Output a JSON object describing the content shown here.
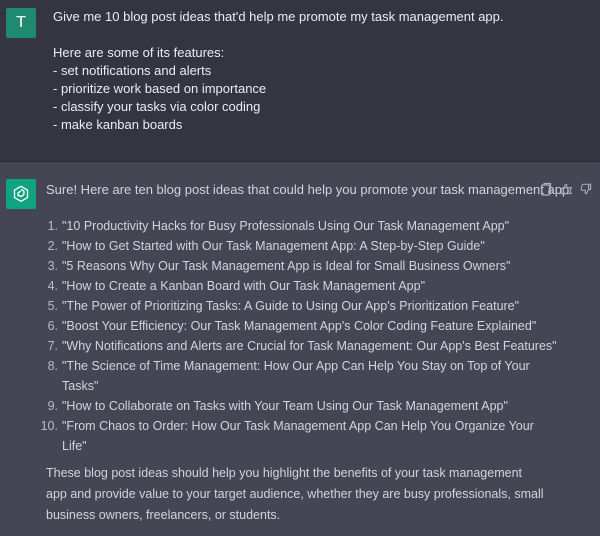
{
  "user": {
    "avatar_initial": "T",
    "avatar_color": "#1f8a70",
    "message_lines": [
      "Give me 10 blog post ideas that'd help me promote my task management app.",
      "",
      "Here are some of its features:",
      "- set notifications and alerts",
      "- prioritize work based on importance",
      "- classify your tasks via color coding",
      "- make kanban boards"
    ]
  },
  "assistant": {
    "avatar_icon": "openai-logo-icon",
    "avatar_color": "#10a37f",
    "intro": "Sure! Here are ten blog post ideas that could help you promote your task management app:",
    "actions": [
      "copy-icon",
      "thumbs-up-icon",
      "thumbs-down-icon"
    ],
    "ideas": [
      {
        "num": "1.",
        "text": "\"10 Productivity Hacks for Busy Professionals Using Our Task Management App\""
      },
      {
        "num": "2.",
        "text": "\"How to Get Started with Our Task Management App: A Step-by-Step Guide\""
      },
      {
        "num": "3.",
        "text": "\"5 Reasons Why Our Task Management App is Ideal for Small Business Owners\""
      },
      {
        "num": "4.",
        "text": "\"How to Create a Kanban Board with Our Task Management App\""
      },
      {
        "num": "5.",
        "text": "\"The Power of Prioritizing Tasks: A Guide to Using Our App's Prioritization Feature\""
      },
      {
        "num": "6.",
        "text": "\"Boost Your Efficiency: Our Task Management App's Color Coding Feature Explained\""
      },
      {
        "num": "7.",
        "text": "\"Why Notifications and Alerts are Crucial for Task Management: Our App's Best Features\""
      },
      {
        "num": "8.",
        "text": "\"The Science of Time Management: How Our App Can Help You Stay on Top of Your Tasks\""
      },
      {
        "num": "9.",
        "text": "\"How to Collaborate on Tasks with Your Team Using Our Task Management App\""
      },
      {
        "num": "10.",
        "text": "\"From Chaos to Order: How Our Task Management App Can Help You Organize Your Life\""
      }
    ],
    "outro": "These blog post ideas should help you highlight the benefits of your task management app and provide value to your target audience, whether they are busy professionals, small business owners, freelancers, or students."
  }
}
